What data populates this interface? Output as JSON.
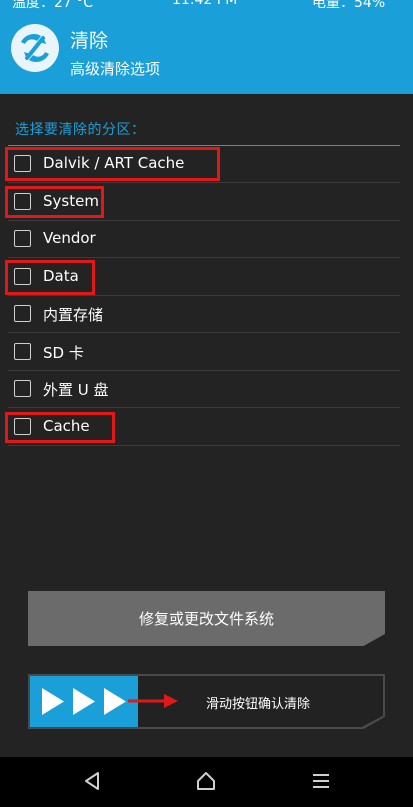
{
  "status_bar": {
    "temp": "温度：27 °C",
    "time": "11:42 PM",
    "battery": "电量：54%"
  },
  "header": {
    "title": "清除",
    "subtitle": "高级清除选项"
  },
  "section": {
    "title": "选择要清除的分区："
  },
  "partitions": [
    {
      "label": "Dalvik / ART Cache",
      "checked": false,
      "highlighted": true
    },
    {
      "label": "System",
      "checked": false,
      "highlighted": true
    },
    {
      "label": "Vendor",
      "checked": false,
      "highlighted": false
    },
    {
      "label": "Data",
      "checked": false,
      "highlighted": true
    },
    {
      "label": "内置存储",
      "checked": false,
      "highlighted": false
    },
    {
      "label": "SD 卡",
      "checked": false,
      "highlighted": false
    },
    {
      "label": "外置 U 盘",
      "checked": false,
      "highlighted": false
    },
    {
      "label": "Cache",
      "checked": false,
      "highlighted": true
    }
  ],
  "buttons": {
    "repair_fs": "修复或更改文件系统",
    "swipe_confirm": "滑动按钮确认清除"
  },
  "nav": {
    "back": "back-icon",
    "home": "home-icon",
    "menu": "menu-icon"
  },
  "colors": {
    "accent": "#1a9fd8",
    "highlight": "#e01818",
    "background": "#232323"
  }
}
